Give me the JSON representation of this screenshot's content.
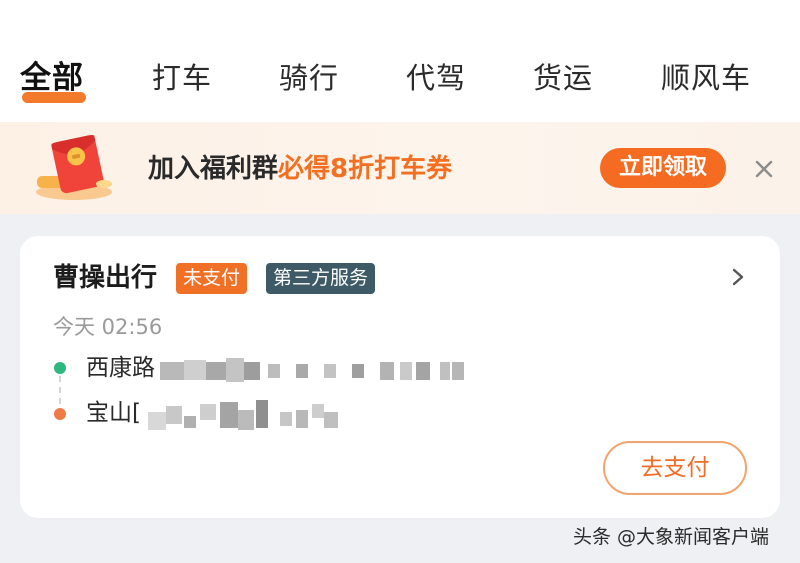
{
  "tabs": [
    {
      "label": "全部",
      "active": true
    },
    {
      "label": "打车",
      "active": false
    },
    {
      "label": "骑行",
      "active": false
    },
    {
      "label": "代驾",
      "active": false
    },
    {
      "label": "货运",
      "active": false
    },
    {
      "label": "顺风车",
      "active": false
    }
  ],
  "promo": {
    "text_dark": "加入福利群",
    "text_highlight": "必得8折打车券",
    "button_label": "立即领取",
    "icon": "red-envelope-icon",
    "close_icon": "close-icon"
  },
  "order": {
    "provider": "曹操出行",
    "status_badge": "未支付",
    "service_badge": "第三方服务",
    "time": "今天 02:56",
    "start_address": "西康路",
    "end_address": "宝山[",
    "pay_button": "去支付",
    "chevron_icon": "chevron-right-icon"
  },
  "watermark": "头条 @大象新闻客户端",
  "colors": {
    "accent": "#f46b21",
    "badge_unpaid": "#f07126",
    "badge_third_party": "#3d5a66",
    "start_dot": "#2fb87e",
    "end_dot": "#f07a45"
  }
}
